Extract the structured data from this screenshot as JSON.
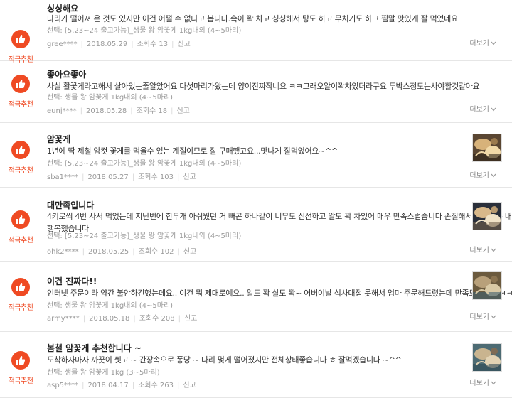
{
  "badge_label": "적극추천",
  "more_label": "더보기",
  "views_prefix": "조회수",
  "report_label": "신고",
  "reviews": [
    {
      "title": "싱싱해요",
      "lines": [
        "다리가 떨어져 온 것도 있지만 이건 어쩔 수 없다고 봅니다.속이 꽉 차고 싱싱해서 탕도 하고 무치기도 하고 찜말 맛있게 잘 먹었네요"
      ],
      "option": "선택: [5.23~24 출고가능]_생물 왕 암꽃게 1kg내외 (4~5마리)",
      "user": "gree****",
      "date": "2018.05.29",
      "views": "13",
      "has_photo": false
    },
    {
      "title": "좋아요좋아",
      "lines": [
        "사실 활꽃게라고해서 살아있는줄알았어요 다섯마리가왔는데 양이진짜작네요 ㅋㅋ그래오알이꽉차있더라구요 두박스정도는사야할것같아요"
      ],
      "option": "선택: 생물 왕 암꽃게 1kg내외 (4~5마리)",
      "user": "eunj****",
      "date": "2018.05.28",
      "views": "18",
      "has_photo": false
    },
    {
      "title": "암꽃게",
      "lines": [
        "1년에 딱 제철 암컷 꽃게를 먹을수 있는 계절이므로 잘 구매했고요...맛나게 잘먹었어요~^^"
      ],
      "option": "선택: [5.23~24 출고가능]_생물 왕 암꽃게 1kg내외 (4~5마리)",
      "user": "sba1****",
      "date": "2018.05.27",
      "views": "103",
      "has_photo": true
    },
    {
      "title": "대만족입니다",
      "lines": [
        "4키로씩 4번 사서 먹었는데 지난번에 한두개 아쉬웠던 거 빼곤 하나같이 너무도 신선하고 알도 꽉 차있어 매우 만족스럽습니다 손질해서 요리하는 내내",
        "행복했습니다"
      ],
      "option": "선택: [5.23~24 출고가능]_생물 왕 암꽃게 1kg내외 (4~5마리)",
      "user": "ohk2****",
      "date": "2018.05.25",
      "views": "102",
      "has_photo": true
    },
    {
      "title": "이건 진짜다!!",
      "lines": [
        "인터넷 주문이라 약간 불안하긴했는데요.. 이건 뭐 제대로예요.. 알도 꽉 살도 꽉~ 어버이날 식사대접 못해서 엄마 주문해드렸는데 만족도 천프로ㅋㅋㅋ"
      ],
      "option": "선택: 생물 왕 암꽃게 1kg내외 (4~5마리)",
      "user": "army****",
      "date": "2018.05.18",
      "views": "208",
      "has_photo": true
    },
    {
      "title": "봄철 암꽃게 추천합니다 ~",
      "lines": [
        "도착하자마자 까꿋이 씻고 ~ 간장속으로 퐁당 ~ 다리 몇게 떨어졌지만 전체상태좋습니다 ㅎ 잘먹겠습니다 ~^^"
      ],
      "option": "선택: 생물 왕 암꽃게 1kg (3~5마리)",
      "user": "asp5****",
      "date": "2018.04.17",
      "views": "263",
      "has_photo": true
    }
  ],
  "colors": {
    "accent": "#ef4a23",
    "meta": "#9a9a9a",
    "divider": "#e6e6e6"
  },
  "icons": {
    "badge": "thumbs-up-icon",
    "more": "chevron-down-icon"
  }
}
